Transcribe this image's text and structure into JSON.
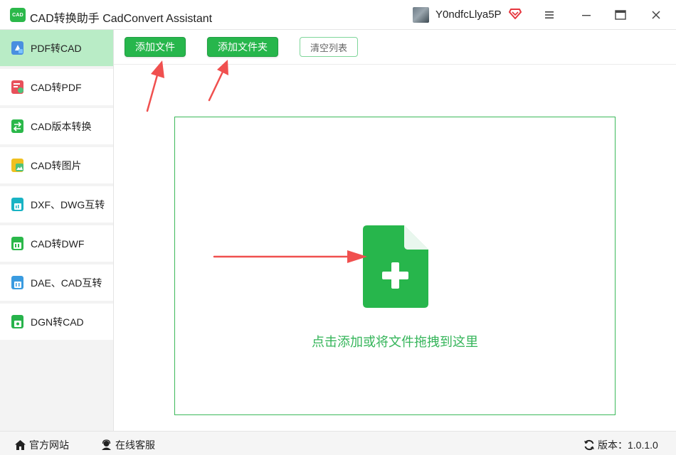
{
  "app": {
    "logo_text": "CAD",
    "title": "CAD转换助手 CadConvert Assistant"
  },
  "user": {
    "name": "Y0ndfcLlya5P",
    "vip_icon": "diamond-vip-icon",
    "vip_color": "#e6363e"
  },
  "window_controls": [
    "menu-icon",
    "minimize-icon",
    "maximize-icon",
    "close-icon"
  ],
  "sidebar": {
    "items": [
      {
        "label": "PDF转CAD",
        "active": true,
        "icon_color": "#4a8fe0"
      },
      {
        "label": "CAD转PDF",
        "active": false,
        "icon_color": "#e8505b"
      },
      {
        "label": "CAD版本转换",
        "active": false,
        "icon_color": "#2bb84a"
      },
      {
        "label": "CAD转图片",
        "active": false,
        "icon_color": "#f0a928"
      },
      {
        "label": "DXF、DWG互转",
        "active": false,
        "icon_color": "#19b3c4"
      },
      {
        "label": "CAD转DWF",
        "active": false,
        "icon_color": "#2bb84a"
      },
      {
        "label": "DAE、CAD互转",
        "active": false,
        "icon_color": "#3a9be0"
      },
      {
        "label": "DGN转CAD",
        "active": false,
        "icon_color": "#27b34b"
      }
    ]
  },
  "toolbar": {
    "add_file_label": "添加文件",
    "add_folder_label": "添加文件夹",
    "clear_list_label": "清空列表"
  },
  "dropzone": {
    "icon": "add-file-icon",
    "hint": "点击添加或将文件拖拽到这里"
  },
  "footer": {
    "website_label": "官方网站",
    "service_label": "在线客服",
    "version_prefix": "版本：",
    "version": "1.0.1.0"
  },
  "colors": {
    "accent": "#27b64c",
    "sidebar_active": "#b9ecc6",
    "annotation_arrow": "#f0504f"
  }
}
